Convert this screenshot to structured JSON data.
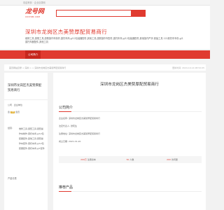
{
  "topbar": {
    "text": "欢迎来到 · 企业目录网"
  },
  "logo": {
    "main": "龙号网",
    "sub": "CIDYOB.COM"
  },
  "site": {
    "title": "深圳市龙岗区杰美赞厚配贸易商行",
    "description": "维修工具,康熙工具,康熙操作车制作,康托车商,g/12包装器配件,其他工具,康熙操作车配件,康托车商,g/12包装器配件,其他操作严厉 原始工具 122原托车年份,g/1康托车器配件,其他工具"
  },
  "nav": {
    "company_intro": "公司简介"
  },
  "breadcrumb": {
    "text": "首页网站目录 > 深圳 > > 深圳市龙岗区杰美赞厚配贸易商行",
    "time": "更新时间: 2024-10-14 08:52:05"
  },
  "sidebar": {
    "company_name": "深圳市龙岗区杰美赞厚配贸易商行",
    "type_line": "公司 · 企业单位",
    "contact_prefix": "会 ",
    "vip_badge": "VIP",
    "contact_suffix": " 会员",
    "scope_label": "经营:",
    "scope_text": "维修工具,康熙工具,康熙操作车制作,康托车商,g/12包装器配件,其他工具,康熙操作车配件,康托车商,g/12包装器配件,康托车商,g/1配件",
    "products_label": "产品分类"
  },
  "main": {
    "title": "深圳市龙岗区杰美赞厚配贸易商行",
    "info_title": "公司简介",
    "info_lines": [
      "企业名称: 深圳市龙岗区杰美赞厚配贸易商行",
      "法定代表人: 张晓生",
      "注册地址: 深圳市龙岗区杰美赞厚配贸易商行",
      "成立日期: 2021-01-20"
    ],
    "stats": [
      {
        "label": "注册资本",
        "value": "200万"
      },
      {
        "label": "人数",
        "value": "50"
      },
      {
        "label": "访问量",
        "value": "200"
      }
    ],
    "products_title": "推荐产品"
  },
  "colors": {
    "accent": "#e03a2f",
    "nav_active": "#c7271d",
    "vip": "#e0ac2a"
  }
}
